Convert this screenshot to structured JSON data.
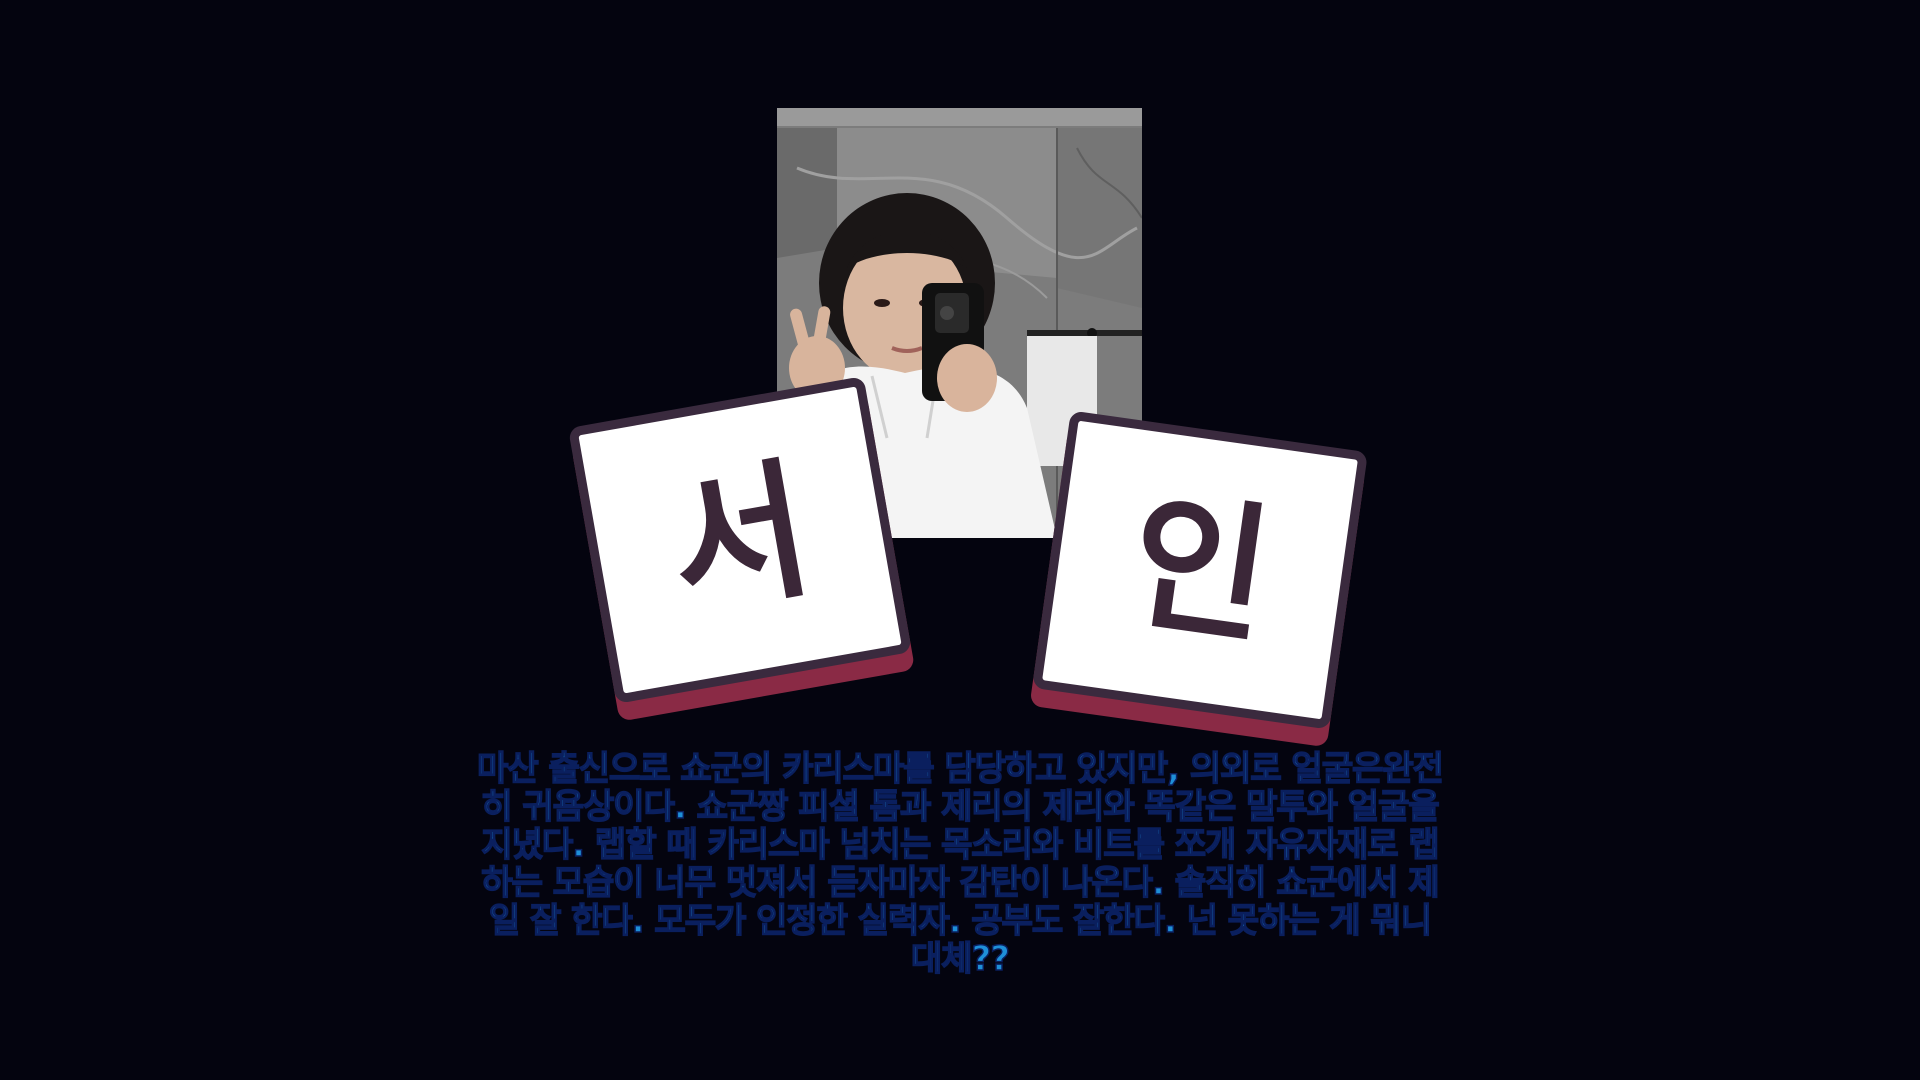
{
  "profile": {
    "name_chars": [
      "서",
      "인"
    ],
    "photo_alt": "mirror selfie in white hoodie",
    "description": "마산 출신으로 쇼군의 카리스마를 담당하고 있지만, 의외로 얼굴은완전히 귀욤상이다. 쇼군짱 피셜 톰과 제리의 제리와  똑같은 말투와 얼굴을 지녔다. 랩할 때 카리스마 넘치는 목소리와 비트를 쪼개 자유자재로 랩하는 모습이 너무 멋져서 듣자마자 감탄이 나온다. 솔직히 쇼군에서 제일 잘 한다. 모두가 인정한 실력자. 공부도 잘한다. 넌 못하는 게 뭐니 대체??"
  },
  "colors": {
    "background": "#04040f",
    "tile_face": "#ffffff",
    "tile_border": "#3a2a3e",
    "tile_shadow": "#8a2a45",
    "tile_text": "#3b2738",
    "description_text": "#1e8fd8",
    "description_outline": "#0a1f5e"
  }
}
